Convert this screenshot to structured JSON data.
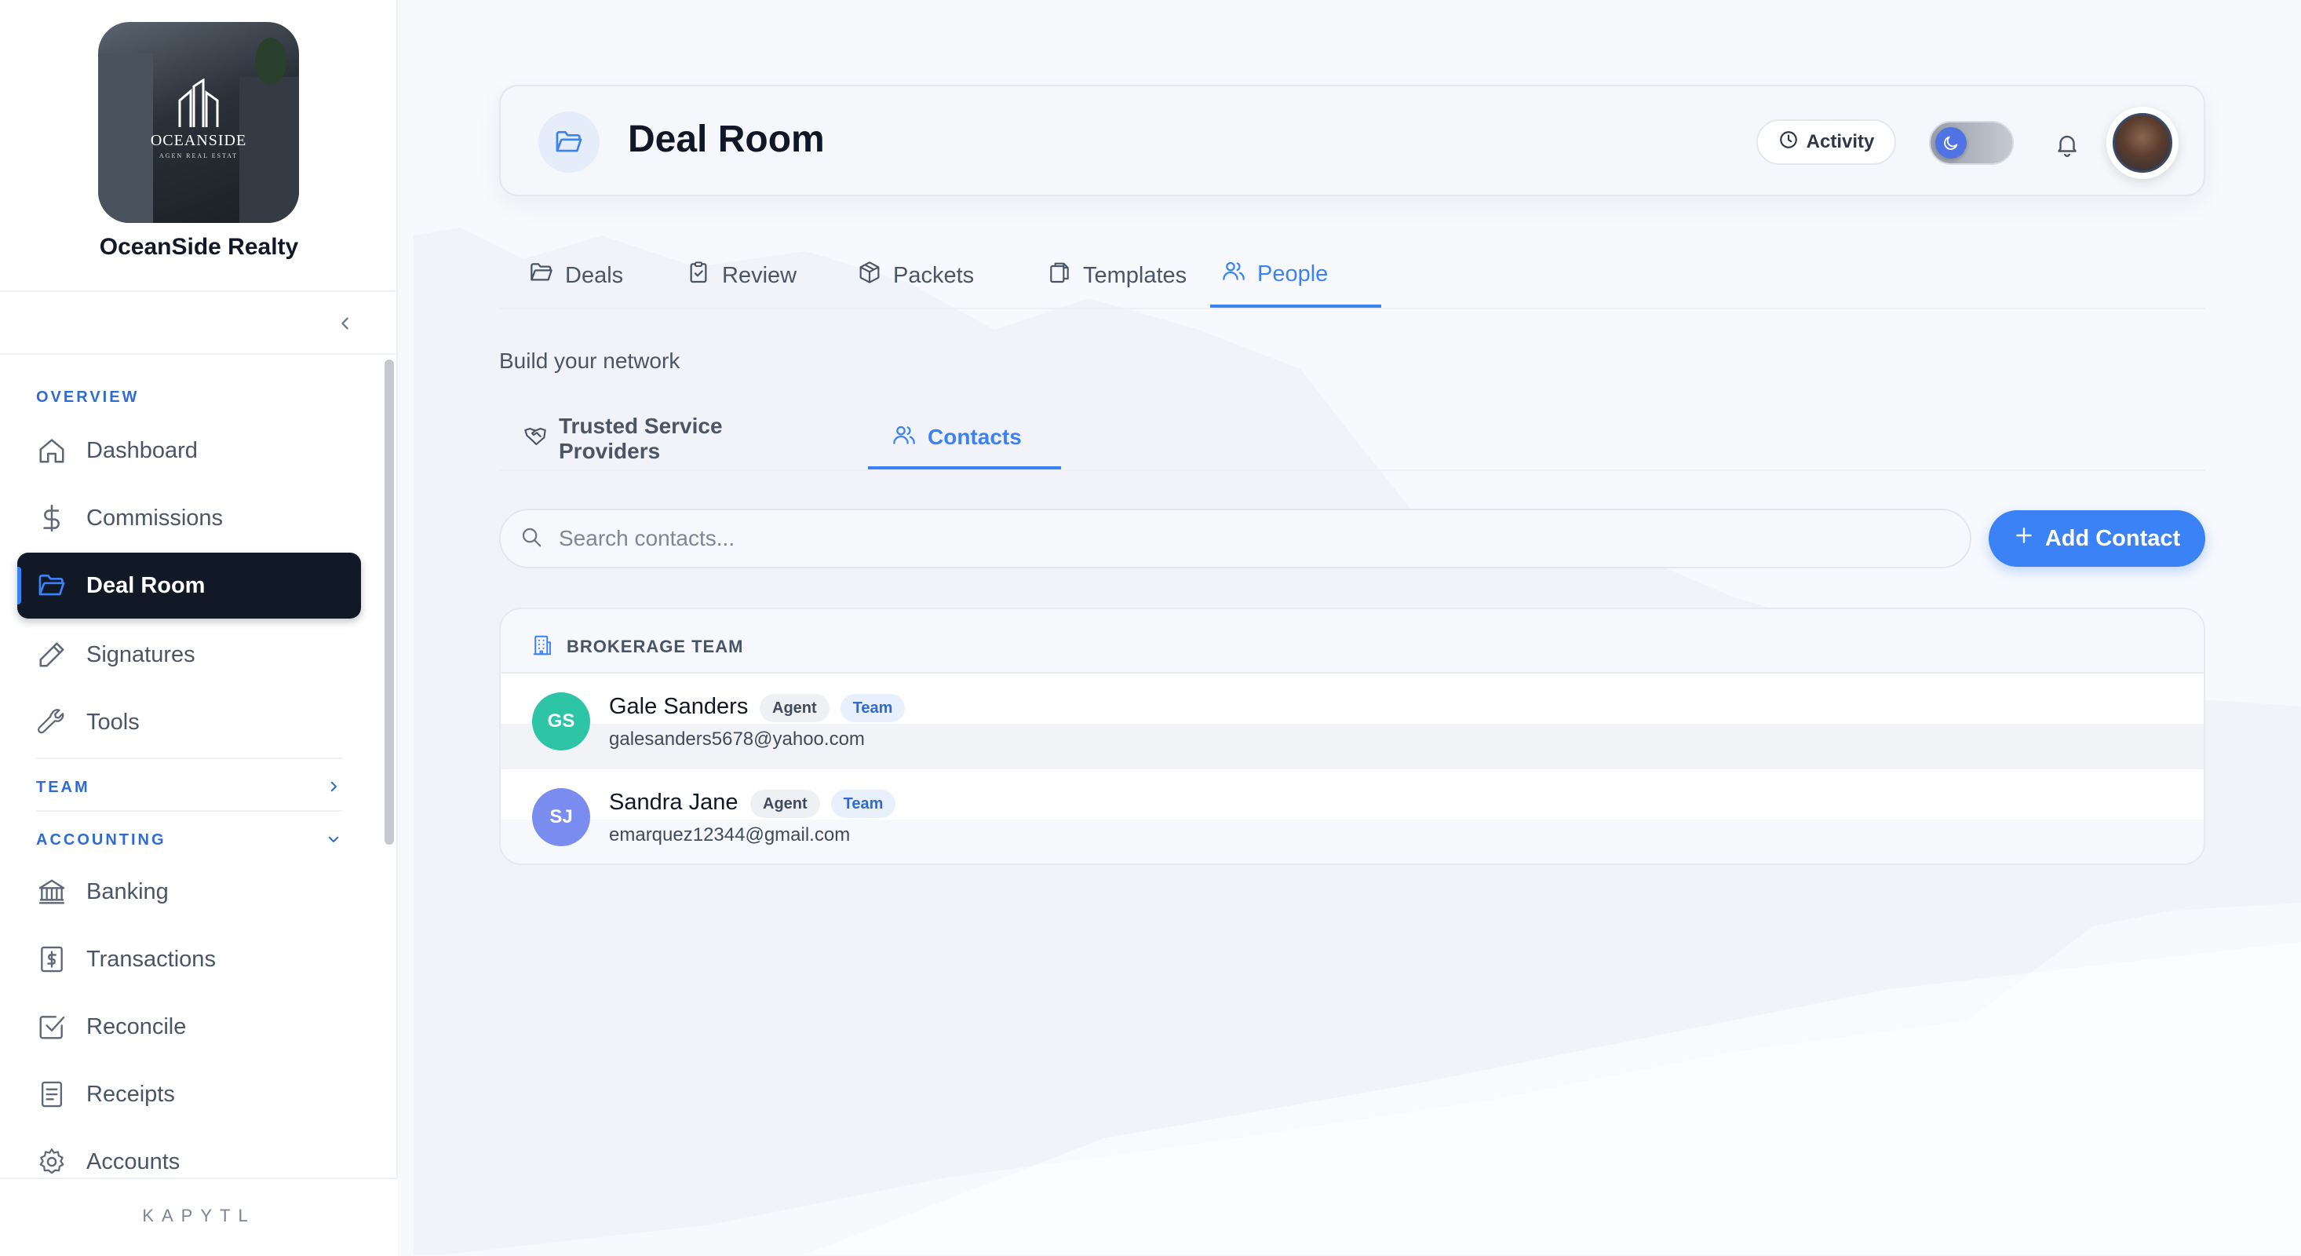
{
  "org": {
    "name": "OceanSide Realty",
    "logo_text": "OCEANSIDE",
    "logo_subtext": "AGEN REAL ESTAT"
  },
  "sidebar": {
    "sections": {
      "overview": "OVERVIEW",
      "team": "TEAM",
      "accounting": "ACCOUNTING"
    },
    "overview_items": [
      {
        "label": "Dashboard",
        "icon": "home-icon"
      },
      {
        "label": "Commissions",
        "icon": "dollar-icon"
      },
      {
        "label": "Deal Room",
        "icon": "folder-icon",
        "active": true
      },
      {
        "label": "Signatures",
        "icon": "pen-icon"
      },
      {
        "label": "Tools",
        "icon": "wrench-icon"
      }
    ],
    "accounting_items": [
      {
        "label": "Banking",
        "icon": "bank-icon"
      },
      {
        "label": "Transactions",
        "icon": "receipt-dollar-icon"
      },
      {
        "label": "Reconcile",
        "icon": "check-square-icon"
      },
      {
        "label": "Receipts",
        "icon": "document-icon"
      },
      {
        "label": "Accounts",
        "icon": "gear-icon"
      }
    ],
    "footer_brand": "KAPYTL"
  },
  "header": {
    "title": "Deal Room",
    "activity_label": "Activity"
  },
  "tabs": [
    {
      "label": "Deals",
      "icon": "folder-icon"
    },
    {
      "label": "Review",
      "icon": "clipboard-icon"
    },
    {
      "label": "Packets",
      "icon": "box-icon"
    },
    {
      "label": "Templates",
      "icon": "copy-icon"
    },
    {
      "label": "People",
      "icon": "users-icon",
      "active": true
    }
  ],
  "people": {
    "subtitle": "Build your network",
    "subtabs": [
      {
        "label": "Trusted Service Providers",
        "icon": "handshake-icon"
      },
      {
        "label": "Contacts",
        "icon": "users-icon",
        "active": true
      }
    ],
    "search_placeholder": "Search contacts...",
    "add_button": "Add Contact",
    "group_title": "BROKERAGE TEAM",
    "contacts": [
      {
        "initials": "GS",
        "name": "Gale Sanders",
        "role": "Agent",
        "tag": "Team",
        "email": "galesanders5678@yahoo.com",
        "color": "#2ec4a6"
      },
      {
        "initials": "SJ",
        "name": "Sandra Jane",
        "role": "Agent",
        "tag": "Team",
        "email": "emarquez12344@gmail.com",
        "color": "#7b8cf0"
      }
    ]
  },
  "colors": {
    "accent": "#3b82f6",
    "sidebar_active_bg": "#111826",
    "section_heading": "#2f6bd3"
  }
}
